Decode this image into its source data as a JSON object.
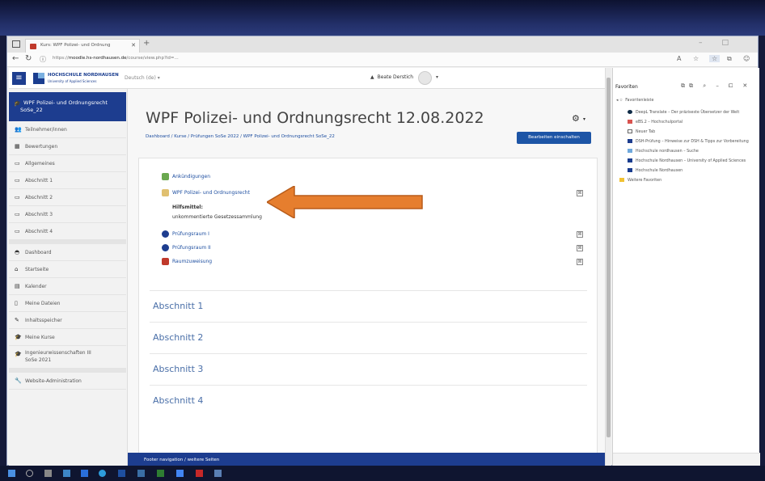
{
  "browser": {
    "tab_title": "Kurs: WPF Polizei- und Ordnung",
    "new_tab": "+",
    "url_prefix": "https://",
    "url_host": "moodle.hs-nordhausen.de",
    "url_path": "/course/view.php?id=..."
  },
  "moodle": {
    "logo_line1": "HOCHSCHULE NORDHAUSEN",
    "logo_line2": "University of Applied Sciences",
    "language": "Deutsch (de) ▾",
    "user_name": "Beate Derstich",
    "course_title": "WPF Polizei- und Ordnungsrecht 12.08.2022",
    "breadcrumb": "Dashboard / Kurse / Prüfungen SoSe 2022 / WPF Polizei- und Ordnungsrecht SoSe_22",
    "edit_button": "Bearbeiten einschalten",
    "footer": "Footer navigation / weitere Seiten"
  },
  "drawer": {
    "course": "WPF Polizei- und Ordnungsrecht SoSe_22",
    "items": [
      "Teilnehmer/innen",
      "Bewertungen",
      "Allgemeines",
      "Abschnitt 1",
      "Abschnitt 2",
      "Abschnitt 3",
      "Abschnitt 4"
    ],
    "nav": [
      "Dashboard",
      "Startseite",
      "Kalender",
      "Meine Dateien",
      "Inhaltsspeicher",
      "Meine Kurse",
      "Ingenieurwissenschaften III SoSe 2021"
    ],
    "admin": "Website-Administration"
  },
  "sections": {
    "top_items": [
      {
        "label": "Ankündigungen"
      },
      {
        "label": "WPF Polizei- und Ordnungsrecht"
      },
      {
        "label": "Prüfungsraum I"
      },
      {
        "label": "Prüfungsraum II"
      },
      {
        "label": "Raumzuweisung"
      }
    ],
    "hilfsmittel_label": "Hilfsmittel:",
    "hilfsmittel_text": "unkommentierte Gesetzessammlung",
    "abschnitte": [
      "Abschnitt 1",
      "Abschnitt 2",
      "Abschnitt 3",
      "Abschnitt 4"
    ]
  },
  "favorites": {
    "title": "Favoriten",
    "bar": "Favoritenleiste",
    "items": [
      "DeepL Translate – Der präziseste Übersetzer der Welt",
      "eBS.2 – Hochschulportal",
      "Neuer Tab",
      "DSH-Prüfung – Hinweise zur DSH & Tipps zur Vorbereitung",
      "Hochschule nordhausen – Suche",
      "Hochschule Nordhausen – University of Applied Sciences",
      "Hochschule Nordhausen"
    ],
    "other": "Weitere Favoriten"
  },
  "colors": {
    "primary": "#1d3d8f",
    "link": "#1d4ea0",
    "arrow": "#e67e2e"
  }
}
